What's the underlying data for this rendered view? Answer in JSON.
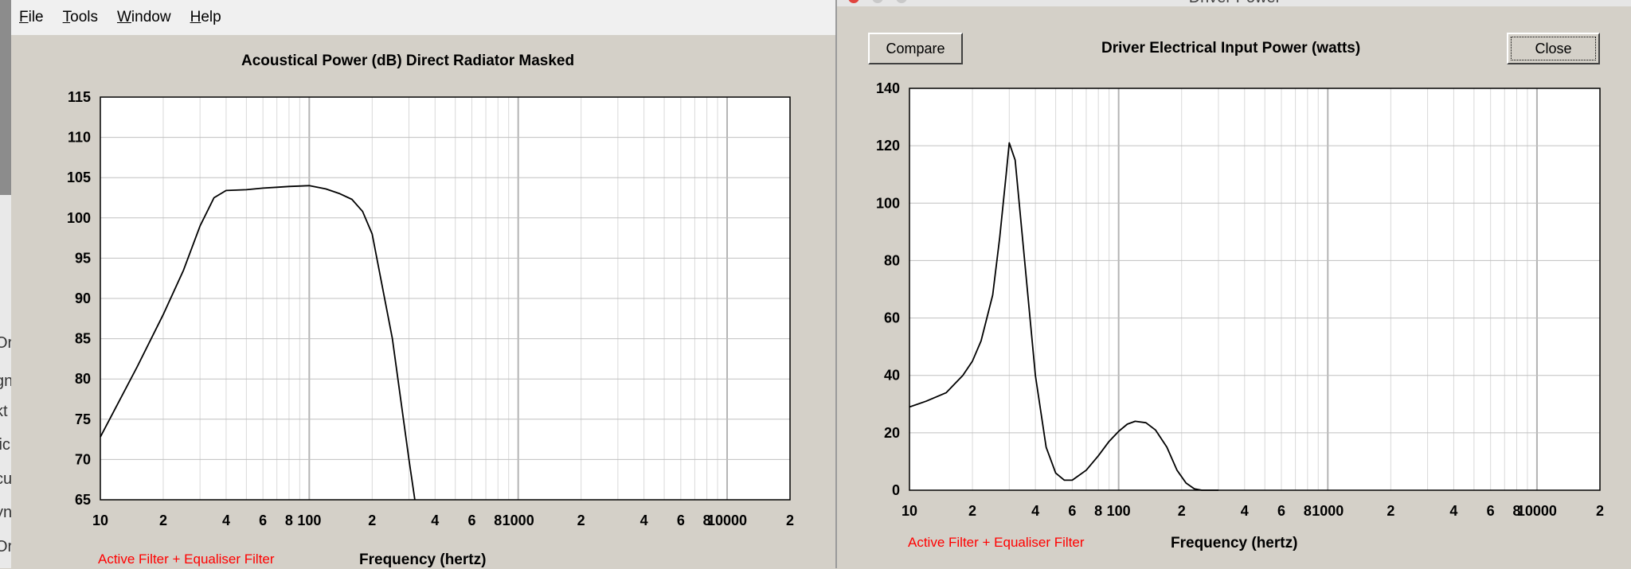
{
  "menu": {
    "items": [
      {
        "key": "F",
        "rest": "ile"
      },
      {
        "key": "T",
        "rest": "ools"
      },
      {
        "key": "W",
        "rest": "indow"
      },
      {
        "key": "H",
        "rest": "elp"
      }
    ]
  },
  "left_panel": {
    "title": "Acoustical Power (dB)   Direct Radiator   Masked",
    "filter_label": "Active Filter + Equaliser Filter",
    "xlabel": "Frequency (hertz)"
  },
  "right_panel": {
    "window_title": "Driver Power",
    "compare_label": "Compare",
    "close_label": "Close",
    "title": "Driver Electrical Input Power (watts)",
    "filter_label": "Active Filter + Equaliser Filter",
    "xlabel": "Frequency (hertz)"
  },
  "left_strip_fragments": [
    "Or",
    "gn",
    "kt",
    "lic",
    "cu",
    "yn",
    "Or"
  ],
  "colors": {
    "background": "#d4d0c8",
    "plot_bg": "#ffffff",
    "grid": "#c0c0c0",
    "curve": "#000000",
    "filter_label": "#ff0000"
  },
  "chart_data": [
    {
      "type": "line",
      "title": "Acoustical Power (dB)   Direct Radiator   Masked",
      "xlabel": "Frequency (hertz)",
      "ylabel": "",
      "xscale": "log",
      "xlim": [
        10,
        20000
      ],
      "ylim": [
        65,
        115
      ],
      "x_tick_labels": [
        "10",
        "2",
        "4",
        "6",
        "8",
        "100",
        "2",
        "4",
        "6",
        "8",
        "1000",
        "2",
        "4",
        "6",
        "8",
        "10000",
        "2"
      ],
      "y_tick_labels": [
        "115",
        "110",
        "105",
        "100",
        "95",
        "90",
        "85",
        "80",
        "75",
        "70",
        "65"
      ],
      "y_ticks": [
        115,
        110,
        105,
        100,
        95,
        90,
        85,
        80,
        75,
        70,
        65
      ],
      "grid": true,
      "series": [
        {
          "x": [
            10,
            15,
            20,
            25,
            30,
            35,
            40,
            50,
            60,
            70,
            80,
            100,
            120,
            140,
            160,
            180,
            200,
            250,
            300,
            320
          ],
          "y": [
            72.8,
            81.5,
            88.0,
            93.5,
            99.0,
            102.5,
            103.4,
            103.5,
            103.7,
            103.8,
            103.9,
            104.0,
            103.6,
            103.0,
            102.3,
            100.8,
            98.0,
            85.0,
            70.0,
            65.0
          ]
        }
      ]
    },
    {
      "type": "line",
      "title": "Driver Electrical Input Power (watts)",
      "xlabel": "Frequency (hertz)",
      "ylabel": "",
      "xscale": "log",
      "xlim": [
        10,
        20000
      ],
      "ylim": [
        0,
        140
      ],
      "x_tick_labels": [
        "10",
        "2",
        "4",
        "6",
        "8",
        "100",
        "2",
        "4",
        "6",
        "8",
        "1000",
        "2",
        "4",
        "6",
        "8",
        "10000",
        "2"
      ],
      "y_tick_labels": [
        "140",
        "120",
        "100",
        "80",
        "60",
        "40",
        "20",
        "0"
      ],
      "y_ticks": [
        140,
        120,
        100,
        80,
        60,
        40,
        20,
        0
      ],
      "grid": true,
      "series": [
        {
          "x": [
            10,
            12,
            15,
            18,
            20,
            22,
            25,
            27,
            29,
            30,
            32,
            35,
            40,
            45,
            50,
            55,
            60,
            70,
            80,
            90,
            100,
            110,
            120,
            135,
            150,
            170,
            190,
            210,
            230,
            250,
            300
          ],
          "y": [
            29,
            31,
            34,
            40,
            45,
            52,
            68,
            88,
            110,
            121,
            115,
            85,
            40,
            15,
            6,
            3.5,
            3.5,
            7,
            12,
            17,
            20.5,
            23,
            24,
            23.5,
            21,
            15,
            7,
            2.5,
            0.5,
            0,
            0
          ]
        }
      ]
    }
  ]
}
